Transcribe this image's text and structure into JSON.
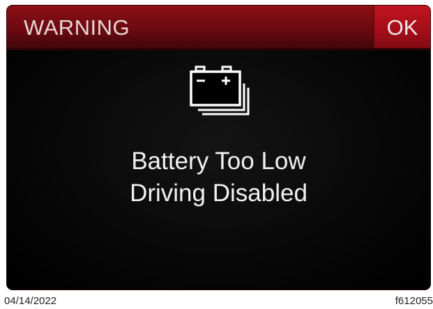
{
  "dialog": {
    "title": "WARNING",
    "ok_label": "OK",
    "icon": "battery-stack-icon",
    "message_line1": "Battery Too Low",
    "message_line2": "Driving Disabled"
  },
  "footer": {
    "date": "04/14/2022",
    "figure_id": "f612055"
  },
  "colors": {
    "header_red": "#8c0f16",
    "ok_red": "#c0141f",
    "screen_background": "#000000",
    "text_white": "#f2f2f2"
  }
}
